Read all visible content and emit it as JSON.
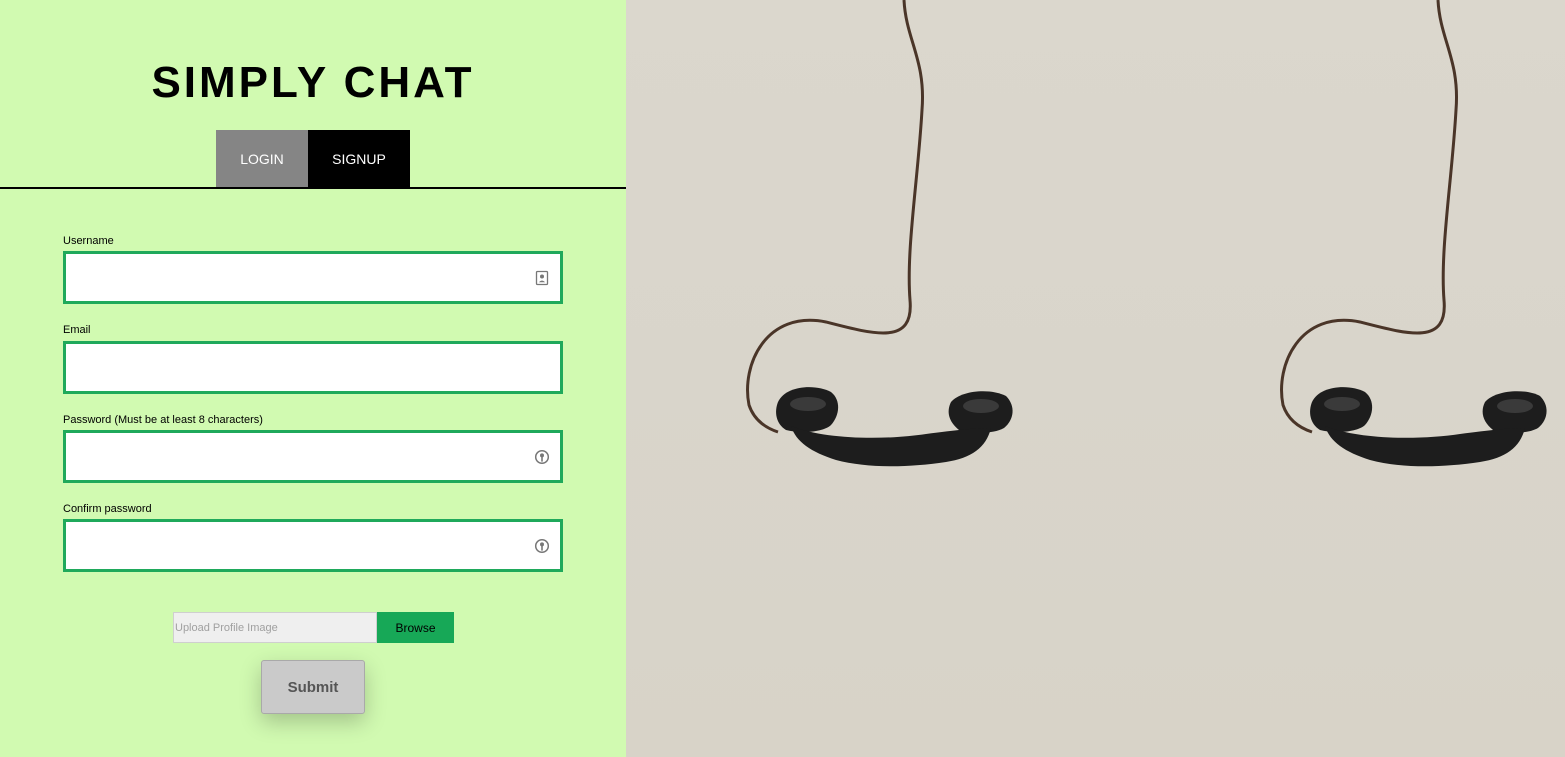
{
  "app": {
    "title": "SIMPLY CHAT"
  },
  "tabs": [
    {
      "label": "LOGIN"
    },
    {
      "label": "SIGNUP"
    }
  ],
  "form": {
    "username": {
      "label": "Username",
      "value": "",
      "placeholder": "",
      "icon": "contact-card-icon"
    },
    "email": {
      "label": "Email",
      "value": "",
      "placeholder": ""
    },
    "password": {
      "label": "Password (Must be at least 8 characters)",
      "value": "",
      "placeholder": "",
      "icon": "key-icon"
    },
    "confirm_password": {
      "label": "Confirm password",
      "value": "",
      "placeholder": "",
      "icon": "key-icon"
    },
    "upload": {
      "placeholder": "Upload Profile Image",
      "browse_label": "Browse"
    },
    "submit_label": "Submit"
  },
  "colors": {
    "left_background": "#d1fab1",
    "field_border": "#1fa95b",
    "browse_button": "#17a857",
    "tab_login": "#858585",
    "tab_signup": "#000000",
    "right_background": "#d9d4ca"
  },
  "right_image": {
    "icon": "telephone-handset-icon"
  }
}
